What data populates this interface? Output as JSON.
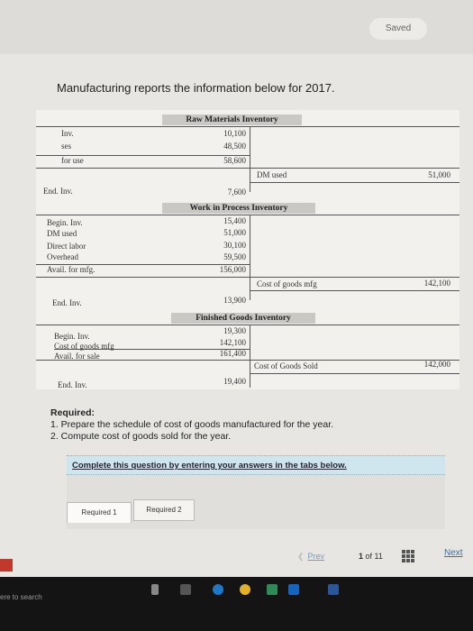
{
  "header": {
    "saved_label": "Saved"
  },
  "intro": "Manufacturing reports the information below for 2017.",
  "raw_materials": {
    "title": "Raw Materials Inventory",
    "left": [
      {
        "label": "Inv.",
        "value": "10,100"
      },
      {
        "label": "ses",
        "value": "48,500"
      },
      {
        "label": "for use",
        "value": "58,600"
      }
    ],
    "right_label": "DM used",
    "right_value": "51,000",
    "end_label": "End. Inv.",
    "end_value": "7,600"
  },
  "wip": {
    "title": "Work in Process Inventory",
    "left": [
      {
        "label": "Begin. Inv.",
        "value": "15,400"
      },
      {
        "label": "DM used",
        "value": "51,000"
      },
      {
        "label": "Direct labor",
        "value": "30,100"
      },
      {
        "label": "Overhead",
        "value": "59,500"
      },
      {
        "label": "Avail. for mfg.",
        "value": "156,000"
      }
    ],
    "right_label": "Cost of goods mfg",
    "right_value": "142,100",
    "end_label": "End. Inv.",
    "end_value": "13,900"
  },
  "finished_goods": {
    "title": "Finished Goods Inventory",
    "left": [
      {
        "label": "Begin. Inv.",
        "value": "19,300"
      },
      {
        "label": "Cost of goods mfg",
        "value": "142,100"
      },
      {
        "label": "Avail. for sale",
        "value": "161,400"
      }
    ],
    "right_label": "Cost of Goods Sold",
    "right_value": "142,000",
    "end_label": "End. Inv.",
    "end_value": "19,400"
  },
  "required": {
    "heading": "Required:",
    "items": [
      "1. Prepare the schedule of cost of goods manufactured for the year.",
      "2. Compute cost of goods sold for the year."
    ]
  },
  "banner": "Complete this question by entering your answers in the tabs below.",
  "tabs": [
    "Required 1",
    "Required 2"
  ],
  "pager": {
    "prev": "Prev",
    "page": "1",
    "of": "of 11",
    "next": "Next"
  },
  "taskbar": {
    "search_text": "ere to search"
  }
}
